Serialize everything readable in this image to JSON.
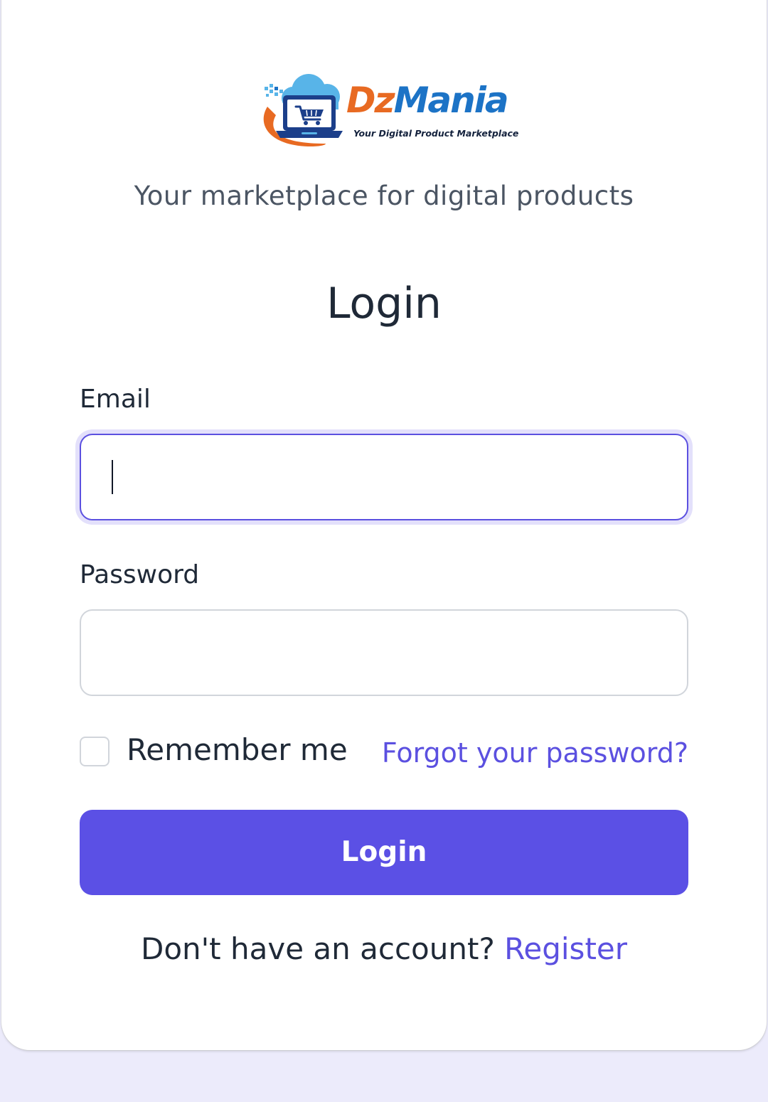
{
  "logo": {
    "name_part1": "Dz",
    "name_part2": "Mania",
    "tagline": "Your Digital Product Marketplace",
    "icon": "laptop-cart-cloud-logo",
    "colors": {
      "orange": "#e86a22",
      "blue": "#1c73c6",
      "cloud": "#58b4e8"
    }
  },
  "subtitle": "Your marketplace for digital products",
  "page_title": "Login",
  "form": {
    "email_label": "Email",
    "email_value": "",
    "password_label": "Password",
    "password_value": "",
    "remember_label": "Remember me",
    "remember_checked": false,
    "forgot_link": "Forgot your password?",
    "submit_label": "Login"
  },
  "footer": {
    "prompt": "Don't have an account?",
    "register_link": "Register"
  },
  "colors": {
    "accent": "#5b50e5",
    "page_background": "#ecebfb",
    "text": "#1f2937",
    "muted_text": "#4b5563"
  }
}
